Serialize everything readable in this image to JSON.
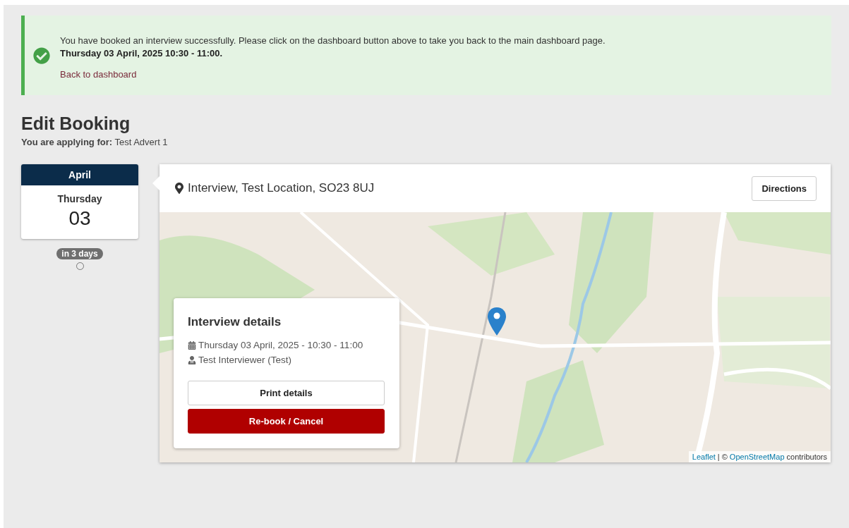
{
  "alert": {
    "message": "You have booked an interview successfully. Please click on the dashboard button above to take you back to the main dashboard page.",
    "datetime": "Thursday 03 April, 2025 10:30 - 11:00.",
    "link": "Back to dashboard"
  },
  "heading": "Edit Booking",
  "applying": {
    "label": "You are applying for:",
    "value": "Test Advert 1"
  },
  "date_card": {
    "month": "April",
    "weekday": "Thursday",
    "day": "03",
    "badge": "in 3 days"
  },
  "location": {
    "text": "Interview, Test Location, SO23 8UJ",
    "button": "Directions"
  },
  "details": {
    "title": "Interview details",
    "lines": [
      {
        "kind": "date",
        "text": "Thursday 03 April, 2025 - 10:30 - 11:00"
      },
      {
        "kind": "person",
        "text": "Test Interviewer (Test)"
      }
    ],
    "buttons": [
      {
        "kind": "secondary",
        "label": "Print details"
      },
      {
        "kind": "danger",
        "label": "Re-book / Cancel"
      }
    ]
  },
  "attribution": {
    "leaflet": "Leaflet",
    "separator": "| ©",
    "osm": "OpenStreetMap",
    "suffix": "contributors"
  }
}
